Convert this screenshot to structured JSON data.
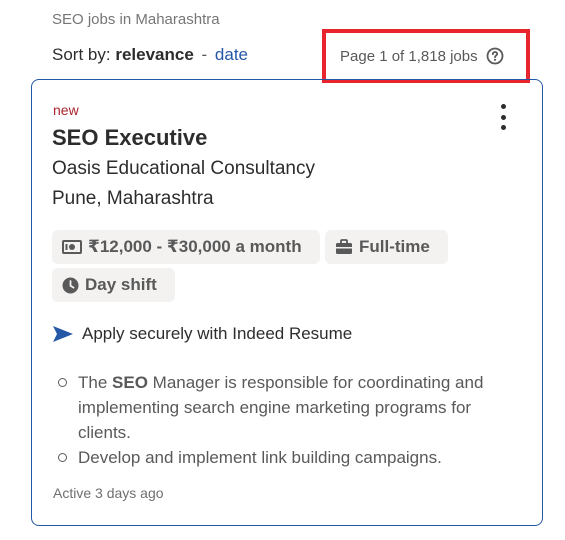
{
  "search": {
    "title": "SEO jobs in Maharashtra"
  },
  "sort": {
    "label": "Sort by:",
    "active": "relevance",
    "separator": "-",
    "other": "date"
  },
  "pagination": {
    "text": "Page 1 of 1,818 jobs",
    "help_icon": "question-circle-icon"
  },
  "highlight_color": "#e8242f",
  "job": {
    "badge": "new",
    "title": "SEO Executive",
    "company": "Oasis Educational Consultancy",
    "location": "Pune, Maharashtra",
    "salary": "₹12,000 - ₹30,000 a month",
    "job_type": "Full-time",
    "shift": "Day shift",
    "apply_text": "Apply securely with Indeed Resume",
    "snippet": [
      {
        "before": "The ",
        "bold": "SEO",
        "after": " Manager is responsible for coordinating and implementing search engine marketing programs for clients."
      },
      {
        "before": "Develop and implement link building campaigns.",
        "bold": "",
        "after": ""
      }
    ],
    "posted": "Active 3 days ago",
    "menu_icon": "kebab-menu-icon"
  }
}
